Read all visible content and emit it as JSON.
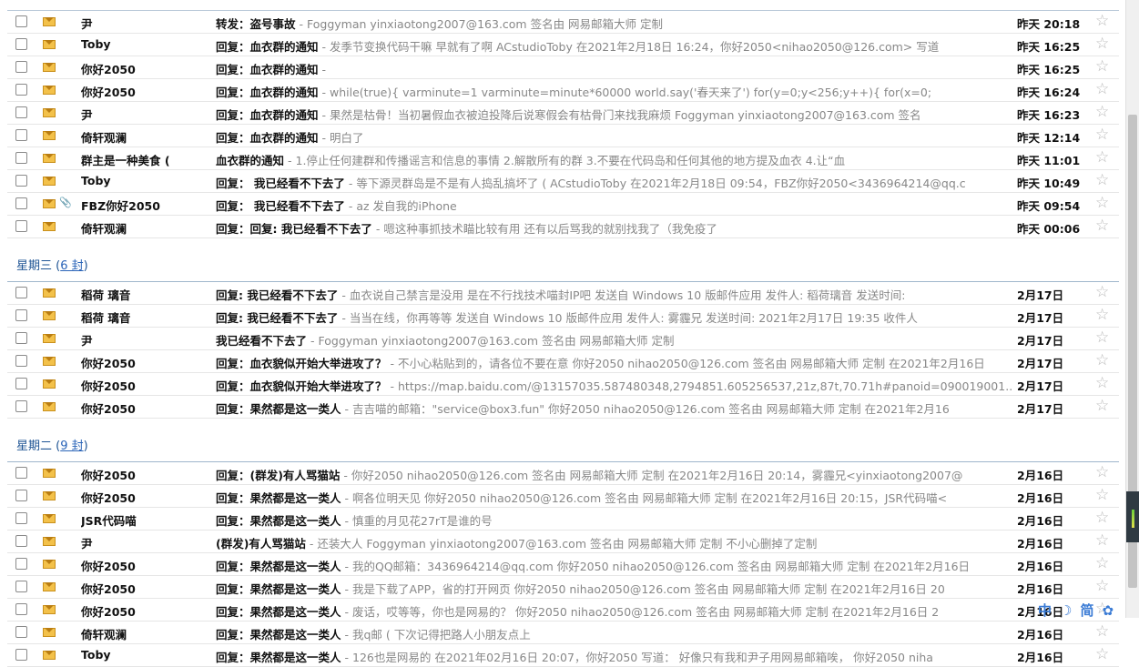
{
  "rows_top": [
    {
      "sender": "尹",
      "subject": "转发：盗号事故",
      "preview": "Foggyman yinxiaotong2007@163.com 签名由 网易邮箱大师 定制",
      "date": "昨天 20:18"
    },
    {
      "sender": "Toby",
      "subject": "回复：血衣群的通知",
      "preview": "发季节变换代码干嘛 早就有了啊 ACstudioToby 在2021年2月18日 16:24，你好2050<nihao2050@126.com> 写道",
      "date": "昨天 16:25"
    },
    {
      "sender": "你好2050",
      "subject": "回复：血衣群的通知",
      "preview": "",
      "date": "昨天 16:25"
    },
    {
      "sender": "你好2050",
      "subject": "回复：血衣群的通知",
      "preview": "while(true){ varminute=1 varminute=minute*60000 world.say('春天来了') for(y=0;y<256;y++){ for(x=0;",
      "date": "昨天 16:24"
    },
    {
      "sender": "尹",
      "subject": "回复：血衣群的通知",
      "preview": "果然是枯骨！当初暑假血衣被迫投降后说寒假会有枯骨门来找我麻烦 Foggyman yinxiaotong2007@163.com 签名",
      "date": "昨天 16:23"
    },
    {
      "sender": "倚轩观澜",
      "subject": "回复：血衣群的通知",
      "preview": "明白了",
      "date": "昨天 12:14"
    },
    {
      "sender": "群主是一种美食 (",
      "subject": "血衣群的通知",
      "preview": "1.停止任何建群和传播谣言和信息的事情 2.解散所有的群 3.不要在代码岛和任何其他的地方提及血衣 4.让“血",
      "date": "昨天 11:01"
    },
    {
      "sender": "Toby",
      "subject": "回复： 我已经看不下去了",
      "preview": "等下源灵群岛是不是有人捣乱搞坏了 (  ACstudioToby 在2021年2月18日 09:54，FBZ你好2050<3436964214@qq.c",
      "date": "昨天 10:49"
    },
    {
      "sender": "FBZ你好2050",
      "subject": "回复： 我已经看不下去了",
      "preview": "az 发自我的iPhone",
      "date": "昨天 09:54",
      "attach": true
    },
    {
      "sender": "倚轩观澜",
      "subject": "回复：回复: 我已经看不下去了",
      "preview": "嗯这种事抓技术瞄比较有用 还有以后骂我的就别找我了（我免疫了",
      "date": "昨天 00:06"
    }
  ],
  "group_wed": {
    "label": "星期三",
    "count_open": " (",
    "count": "6 封",
    "count_close": ")"
  },
  "rows_wed": [
    {
      "sender": "稻荷 璃音",
      "subject": "回复: 我已经看不下去了",
      "preview": "血衣说自己禁言是没用 是在不行找技术喵封IP吧 发送自 Windows 10 版邮件应用 发件人: 稻荷璃音 发送时间:",
      "date": "2月17日"
    },
    {
      "sender": "稻荷 璃音",
      "subject": "回复: 我已经看不下去了",
      "preview": "当当在线，你再等等 发送自 Windows 10 版邮件应用 发件人: 雾霾兄 发送时间: 2021年2月17日 19:35 收件人",
      "date": "2月17日"
    },
    {
      "sender": "尹",
      "subject": "我已经看不下去了",
      "preview": "Foggyman yinxiaotong2007@163.com 签名由 网易邮箱大师 定制",
      "date": "2月17日"
    },
    {
      "sender": "你好2050",
      "subject": "回复：血衣貌似开始大举进攻了？",
      "preview": "不小心粘贴到的，请各位不要在意 你好2050 nihao2050@126.com 签名由 网易邮箱大师 定制 在2021年2月16日",
      "date": "2月17日"
    },
    {
      "sender": "你好2050",
      "subject": "回复：血衣貌似开始大举进攻了？",
      "preview": "https://map.baidu.com/@13157035.587480348,2794851.605256537,21z,87t,70.71h#panoid=090019001...",
      "date": "2月17日"
    },
    {
      "sender": "你好2050",
      "subject": "回复：果然都是这一类人",
      "preview": "吉吉喵的邮箱：\"service@box3.fun\" 你好2050 nihao2050@126.com 签名由 网易邮箱大师 定制 在2021年2月16",
      "date": "2月17日"
    }
  ],
  "group_tue": {
    "label": "星期二",
    "count_open": " (",
    "count": "9 封",
    "count_close": ")"
  },
  "rows_tue": [
    {
      "sender": "你好2050",
      "subject": "回复：(群发)有人骂猫站",
      "preview": "你好2050 nihao2050@126.com 签名由 网易邮箱大师 定制 在2021年2月16日 20:14，雾霾兄<yinxiaotong2007@",
      "date": "2月16日"
    },
    {
      "sender": "你好2050",
      "subject": "回复：果然都是这一类人",
      "preview": "啊各位明天见 你好2050 nihao2050@126.com 签名由 网易邮箱大师 定制 在2021年2月16日 20:15，JSR代码喵<",
      "date": "2月16日"
    },
    {
      "sender": "JSR代码喵",
      "subject": "回复：果然都是这一类人",
      "preview": "慎重的月见花27rT是谁的号",
      "date": "2月16日"
    },
    {
      "sender": "尹",
      "subject": "(群发)有人骂猫站",
      "preview": "还装大人 Foggyman yinxiaotong2007@163.com 签名由 网易邮箱大师 定制 不小心删掉了定制",
      "date": "2月16日"
    },
    {
      "sender": "你好2050",
      "subject": "回复：果然都是这一类人",
      "preview": "我的QQ邮箱：3436964214@qq.com 你好2050 nihao2050@126.com 签名由 网易邮箱大师 定制 在2021年2月16日",
      "date": "2月16日"
    },
    {
      "sender": "你好2050",
      "subject": "回复：果然都是这一类人",
      "preview": "我是下载了APP，省的打开网页 你好2050 nihao2050@126.com 签名由 网易邮箱大师 定制 在2021年2月16日 20",
      "date": "2月16日"
    },
    {
      "sender": "你好2050",
      "subject": "回复：果然都是这一类人",
      "preview": "废话，哎等等，你也是网易的？ 你好2050 nihao2050@126.com 签名由 网易邮箱大师 定制 在2021年2月16日 2",
      "date": "2月16日"
    },
    {
      "sender": "倚轩观澜",
      "subject": "回复：果然都是这一类人",
      "preview": "我q邮 (  下次记得把路人小朋友点上",
      "date": "2月16日"
    },
    {
      "sender": "Toby",
      "subject": "回复：果然都是这一类人",
      "preview": "126也是网易的 在2021年02月16日 20:07，你好2050 写道： 好像只有我和尹子用网易邮箱唉， 你好2050 niha",
      "date": "2月16日"
    }
  ],
  "separator": "-",
  "star_glyph": "☆",
  "attach_glyph": "📎",
  "ime": {
    "lang": "中",
    "moon": "☽",
    "mode": "简",
    "settings": "✿"
  },
  "colors": {
    "group_label": "#1e5494",
    "preview": "#888888",
    "envelope": "#f3c14a",
    "star": "#b8b8b8"
  }
}
